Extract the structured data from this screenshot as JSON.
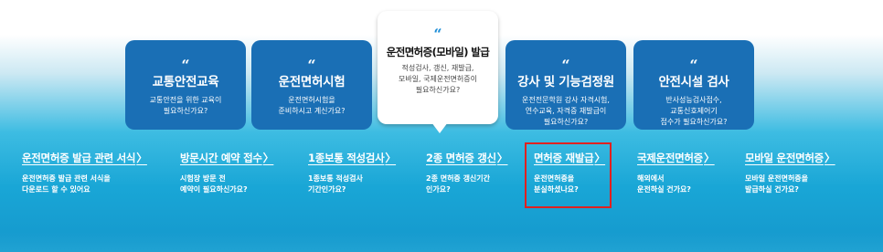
{
  "cards": [
    {
      "quote": "“",
      "title": "교통안전교육",
      "desc": [
        "교통안전을 위한 교육이",
        "필요하신가요?"
      ]
    },
    {
      "quote": "“",
      "title": "운전면허시험",
      "desc": [
        "운전면허시험을",
        "준비하시고 계신가요?"
      ]
    },
    {
      "quote": "“",
      "title": "운전면허증(모바일) 발급",
      "desc": [
        "적성검사, 갱신, 재발급,",
        "모바일, 국제운전면허증이",
        "필요하신가요?"
      ]
    },
    {
      "quote": "“",
      "title": "강사 및 기능검정원",
      "desc": [
        "운전전문학원 강사 자격시험,",
        "연수교육, 자격증 재발급이",
        "필요하신가요?"
      ]
    },
    {
      "quote": "“",
      "title": "안전시설 검사",
      "desc": [
        "반사성능검사접수,",
        "교통신호제어기",
        "접수가 필요하신가요?"
      ]
    }
  ],
  "links": [
    {
      "title": "운전면허증 발급 관련 서식",
      "chev": "〉",
      "desc": [
        "운전면허증 발급 관련 서식을",
        "다운로드 할 수 있어요"
      ]
    },
    {
      "title": "방문시간 예약 접수",
      "chev": "〉",
      "desc": [
        "시험장 방문 전",
        "예약이 필요하신가요?"
      ]
    },
    {
      "title": "1종보통 적성검사",
      "chev": "〉",
      "desc": [
        "1종보통 적성검사",
        "기간인가요?"
      ]
    },
    {
      "title": "2종 면허증 갱신",
      "chev": "〉",
      "desc": [
        "2종 면허증 갱신기간",
        "인가요?"
      ]
    },
    {
      "title": "면허증 재발급",
      "chev": "〉",
      "desc": [
        "운전면허증을",
        "분실하셨나요?"
      ]
    },
    {
      "title": "국제운전면허증",
      "chev": "〉",
      "desc": [
        "해외에서",
        "운전하실 건가요?"
      ]
    },
    {
      "title": "모바일 운전면허증",
      "chev": "〉",
      "desc": [
        "모바일 운전면허증을",
        "발급하실 건가요?"
      ]
    }
  ],
  "colors": {
    "card_bg": "#1a6fb5",
    "featured_bg": "#ffffff",
    "highlight": "#e0211f",
    "quote_accent": "#1a8cd6"
  }
}
